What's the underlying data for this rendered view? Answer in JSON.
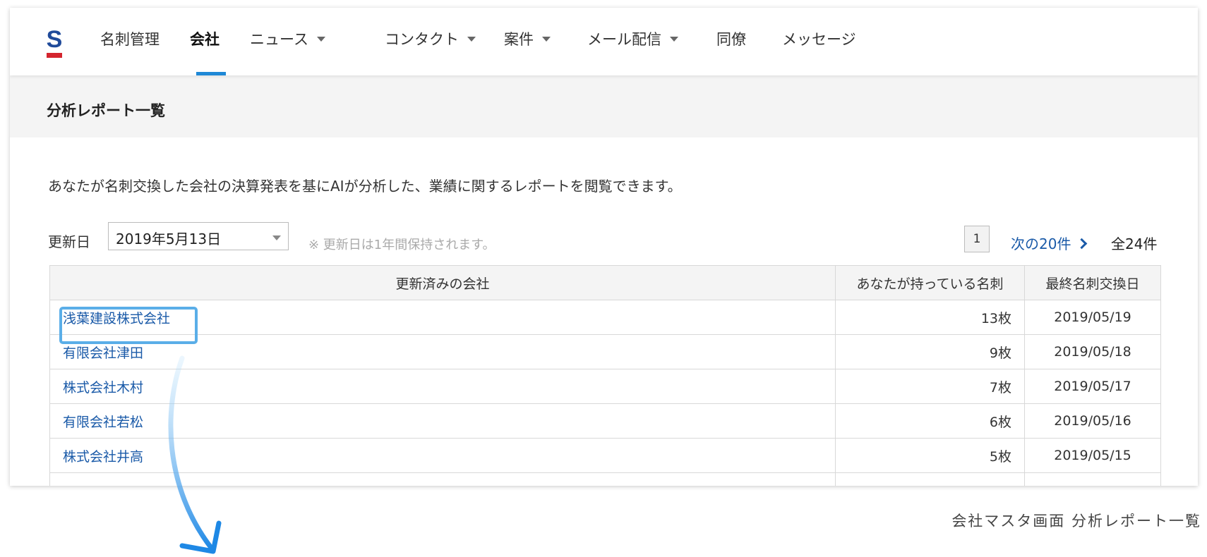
{
  "logo": {
    "letter": "S",
    "brand_color": "#1f4a9a",
    "accent_color": "#d4252e"
  },
  "nav": {
    "items": [
      {
        "label": "名刺管理",
        "dropdown": false
      },
      {
        "label": "会社",
        "dropdown": false,
        "active": true
      },
      {
        "label": "ニュース",
        "dropdown": true
      },
      {
        "label": "コンタクト",
        "dropdown": true
      },
      {
        "label": "案件",
        "dropdown": true
      },
      {
        "label": "メール配信",
        "dropdown": true
      },
      {
        "label": "同僚",
        "dropdown": false
      },
      {
        "label": "メッセージ",
        "dropdown": false
      }
    ]
  },
  "page": {
    "title": "分析レポート一覧",
    "description": "あなたが名刺交換した会社の決算発表を基にAIが分析した、業績に関するレポートを閲覧できます。"
  },
  "filter": {
    "label": "更新日",
    "selected_date": "2019年5月13日",
    "note": "※ 更新日は1年間保持されます。"
  },
  "pagination": {
    "current_page": "1",
    "next_label": "次の20件",
    "total": "全24件"
  },
  "table": {
    "headers": [
      "更新済みの会社",
      "あなたが持っている名刺",
      "最終名刺交換日"
    ],
    "rows": [
      {
        "company": "浅葉建設株式会社",
        "cards": "13枚",
        "last_exchange": "2019/05/19"
      },
      {
        "company": "有限会社津田",
        "cards": "9枚",
        "last_exchange": "2019/05/18"
      },
      {
        "company": "株式会社木村",
        "cards": "7枚",
        "last_exchange": "2019/05/17"
      },
      {
        "company": "有限会社若松",
        "cards": "6枚",
        "last_exchange": "2019/05/16"
      },
      {
        "company": "株式会社井高",
        "cards": "5枚",
        "last_exchange": "2019/05/15"
      }
    ]
  },
  "caption": "会社マスタ画面 分析レポート一覧",
  "colors": {
    "link": "#1a5aa8",
    "active_underline": "#1e88d6",
    "highlight": "#5aaee8"
  }
}
